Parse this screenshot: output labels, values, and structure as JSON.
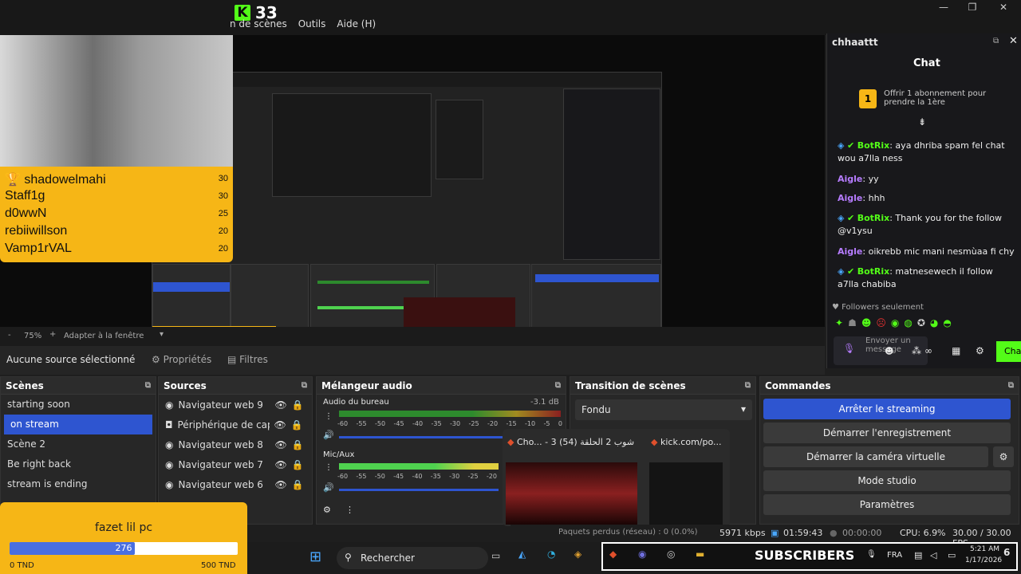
{
  "app": {
    "title": "33",
    "window_controls": [
      "—",
      "❐",
      "✕"
    ]
  },
  "menu": [
    "n de scènes",
    "Outils",
    "Aide (H)"
  ],
  "leaderboard": [
    {
      "name": "shadowelmahi",
      "count": "30"
    },
    {
      "name": "Staff1g",
      "count": "30"
    },
    {
      "name": "d0wwN",
      "count": "25"
    },
    {
      "name": "rebiiwillson",
      "count": "20"
    },
    {
      "name": "Vamp1rVAL",
      "count": "20"
    }
  ],
  "zoom": {
    "minus": "-",
    "value": "75%",
    "plus": "+",
    "fit": "Adapter à la fenêtre"
  },
  "sourcebar": {
    "none": "Aucune source sélectionné",
    "props": "Propriétés",
    "filters": "Filtres"
  },
  "scenes": {
    "title": "Scènes",
    "items": [
      "starting soon",
      "on stream",
      "Scène 2",
      "Be right back",
      "stream is ending"
    ]
  },
  "sources": {
    "title": "Sources",
    "items": [
      "Navigateur web 9",
      "Périphérique de captu",
      "Navigateur web 8",
      "Navigateur web 7",
      "Navigateur web 6"
    ]
  },
  "mixer": {
    "title": "Mélangeur audio",
    "ch1": {
      "name": "Audio du bureau",
      "db": "-3.1 dB"
    },
    "ch2": {
      "name": "Mic/Aux"
    },
    "ticks": [
      "-60",
      "-55",
      "-50",
      "-45",
      "-40",
      "-35",
      "-30",
      "-25",
      "-20",
      "-15",
      "-10",
      "-5",
      "0"
    ]
  },
  "transition": {
    "title": "Transition de scènes",
    "value": "Fondu"
  },
  "commands": {
    "title": "Commandes",
    "buttons": [
      "Arrêter le streaming",
      "Démarrer l'enregistrement",
      "Démarrer la caméra virtuelle",
      "Mode studio",
      "Paramètres"
    ]
  },
  "chat": {
    "header": "chhaattt",
    "title": "Chat",
    "sub_offer": "Offrir 1 abonnement pour prendre la 1ère",
    "sub_count": "1",
    "messages": [
      {
        "user": "BotRix",
        "text": ": aya dhriba spam fel chat wou a7lla ness",
        "color": "#53fc18",
        "bot": true
      },
      {
        "user": "Aigle",
        "text": ": yy",
        "color": "#b67cff",
        "bot": false
      },
      {
        "user": "Aigle",
        "text": ": hhh",
        "color": "#b67cff",
        "bot": false
      },
      {
        "user": "BotRix",
        "text": ": Thank you for the follow @v1ysu",
        "color": "#53fc18",
        "bot": true
      },
      {
        "user": "Aigle",
        "text": ": oikrebb mic mani nesmùaa fi chy",
        "color": "#b67cff",
        "bot": false
      },
      {
        "user": "BotRix",
        "text": ": matnesewech il follow a7lla chabiba",
        "color": "#53fc18",
        "bot": true
      }
    ],
    "followers_only": "Followers seulement",
    "input_placeholder": "Envoyer un message",
    "send": "Cha"
  },
  "popup": {
    "tab1": "Cho... - 3 شوب 2 الحلقة (54)",
    "tab2": "kick.com/po..."
  },
  "status": {
    "lost": "Paquets perdus (réseau) : 0 (0.0%)",
    "kbps": "5971 kbps",
    "stream_time": "01:59:43",
    "rec_time": "00:00:00",
    "cpu": "CPU: 6.9%",
    "fps": "30.00 / 30.00 FPS"
  },
  "fazet": {
    "title": "fazet lil pc",
    "current": "276",
    "min": "0 TND",
    "max": "500 TND",
    "progress": 0.55
  },
  "taskbar": {
    "search": "Rechercher",
    "subs": "SUBSCRIBERS",
    "lang": "FRA",
    "time": "5:21 AM",
    "date": "1/17/2026",
    "badge": "6"
  }
}
